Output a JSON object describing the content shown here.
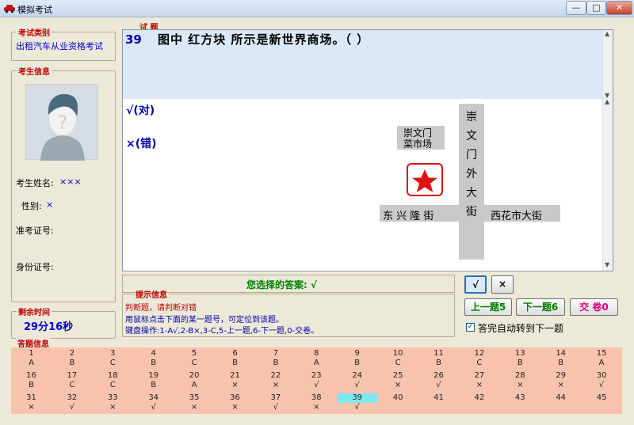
{
  "window": {
    "title": "模拟考试",
    "minimize": "—",
    "maximize": "□",
    "close": "✕",
    "app_icon": "car-icon"
  },
  "exam_type": {
    "legend": "考试类别",
    "text": "出租汽车从业资格考试"
  },
  "candidate": {
    "legend": "考生信息",
    "name_label": "考生姓名:",
    "name_value": "×××",
    "gender_label": "性别:",
    "gender_value": "×",
    "exam_no_label": "准考证号:",
    "id_label": "身份证号:",
    "photo_icon": "person-silhouette-icon"
  },
  "time": {
    "legend": "剩余时间",
    "value": "29分16秒"
  },
  "question": {
    "legend": "试 题",
    "number": "39",
    "text": "图中  红方块  所示是新世界商场。（    ）",
    "option_true": "√(对)",
    "option_false": "×(错)"
  },
  "map": {
    "chongwen_market": [
      "崇文门",
      "菜市场"
    ],
    "chongwen_street": "崇文门外大街",
    "dongxinglong": "东 兴 隆 街",
    "xihuashi": "西花市大街",
    "marker_color": "#dd1111"
  },
  "answer": {
    "label": "您选择的答案: √"
  },
  "hint": {
    "legend": "提示信息",
    "line1": "判断题，请判断对错",
    "line2": "用鼠标点击下面的某一题号，可定位到该题。",
    "line3": "键盘操作:1-A√,2-B×,3-C,5-上一题,6-下一题,0-交卷。"
  },
  "buttons": {
    "true_btn": "√",
    "false_btn": "×",
    "prev": "上一题5",
    "next": "下一题6",
    "submit": "交 卷0",
    "auto_next": "答完自动转到下一题",
    "auto_next_checked": true
  },
  "grid": {
    "legend": "答题信息",
    "current": 39,
    "numbers": [
      "1",
      "2",
      "3",
      "4",
      "5",
      "6",
      "7",
      "8",
      "9",
      "10",
      "11",
      "12",
      "13",
      "14",
      "15",
      "16",
      "17",
      "18",
      "19",
      "20",
      "21",
      "22",
      "23",
      "24",
      "25",
      "26",
      "27",
      "28",
      "29",
      "30",
      "31",
      "32",
      "33",
      "34",
      "35",
      "36",
      "37",
      "38",
      "39",
      "40",
      "41",
      "42",
      "43",
      "44",
      "45"
    ],
    "answers": [
      "A",
      "B",
      "C",
      "B",
      "C",
      "B",
      "B",
      "A",
      "B",
      "C",
      "B",
      "C",
      "B",
      "B",
      "A",
      "B",
      "C",
      "C",
      "B",
      "A",
      "×",
      "×",
      "√",
      "√",
      "×",
      "√",
      "×",
      "×",
      "×",
      "√",
      "×",
      "√",
      "×",
      "√",
      "×",
      "×",
      "√",
      "×",
      "√",
      "",
      "",
      "",
      "",
      "",
      ""
    ]
  }
}
